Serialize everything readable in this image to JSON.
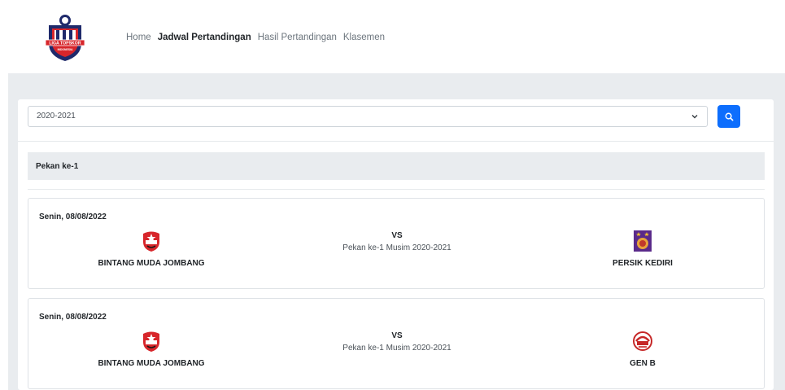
{
  "logo": {
    "text_top": "LIGA TOPSKOR",
    "text_bottom": "INDONESIA",
    "icon": "liga-topskor-logo"
  },
  "nav": {
    "items": [
      {
        "label": "Home",
        "active": false
      },
      {
        "label": "Jadwal Pertandingan",
        "active": true
      },
      {
        "label": "Hasil Pertandingan",
        "active": false
      },
      {
        "label": "Klasemen",
        "active": false
      }
    ]
  },
  "filter": {
    "season_selected": "2020-2021",
    "search_icon": "search-icon"
  },
  "week": {
    "label": "Pekan ke-1"
  },
  "matches": [
    {
      "date": "Senin, 08/08/2022",
      "home": {
        "name": "BINTANG MUDA JOMBANG",
        "icon": "bintang-muda-jombang-crest"
      },
      "vs": "VS",
      "info": "Pekan ke-1 Musim 2020-2021",
      "away": {
        "name": "PERSIK KEDIRI",
        "icon": "persik-kediri-crest"
      }
    },
    {
      "date": "Senin, 08/08/2022",
      "home": {
        "name": "BINTANG MUDA JOMBANG",
        "icon": "bintang-muda-jombang-crest"
      },
      "vs": "VS",
      "info": "Pekan ke-1 Musim 2020-2021",
      "away": {
        "name": "GEN B",
        "icon": "gen-b-crest"
      }
    }
  ],
  "colors": {
    "primary": "#0d6efd",
    "gray_bg": "#e9ecef",
    "logo_navy": "#1f2a6b",
    "logo_red": "#d7262b"
  }
}
